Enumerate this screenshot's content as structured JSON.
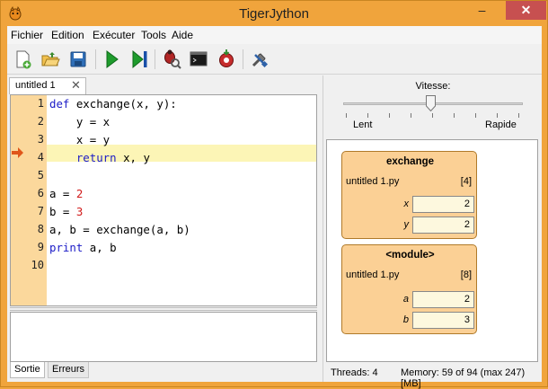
{
  "window": {
    "title": "TigerJython"
  },
  "menu": [
    "Fichier",
    "Edition",
    "Exécuter",
    "Tools",
    "Aide"
  ],
  "toolbar": {
    "icons": [
      "new-file-icon",
      "open-folder-icon",
      "save-icon",
      "run-icon",
      "step-icon",
      "debug-icon",
      "console-icon",
      "stop-icon",
      "tools-icon"
    ]
  },
  "editor": {
    "tab_label": "untitled 1",
    "line_numbers": [
      "1",
      "2",
      "3",
      "4",
      "5",
      "6",
      "7",
      "8",
      "9",
      "10"
    ],
    "current_line": 4
  },
  "output": {
    "tabs": [
      "Sortie",
      "Erreurs"
    ]
  },
  "speed": {
    "label": "Vitesse:",
    "slow": "Lent",
    "fast": "Rapide",
    "level_fraction": 0.5
  },
  "frames": [
    {
      "title": "exchange",
      "file": "untitled 1.py",
      "line": "[4]",
      "vars": [
        {
          "name": "x",
          "value": "2"
        },
        {
          "name": "y",
          "value": "2"
        }
      ]
    },
    {
      "title": "<module>",
      "file": "untitled 1.py",
      "line": "[8]",
      "vars": [
        {
          "name": "a",
          "value": "2"
        },
        {
          "name": "b",
          "value": "3"
        }
      ]
    }
  ],
  "status": {
    "threads": "Threads: 4",
    "memory": "Memory: 59 of 94 (max 247) [MB]"
  },
  "colors": {
    "frame_bg": "#fbd095",
    "gutter": "#fbd89c",
    "current_line": "#fcf5b6",
    "keyword": "#1b1bc7",
    "number": "#d11a1a"
  }
}
